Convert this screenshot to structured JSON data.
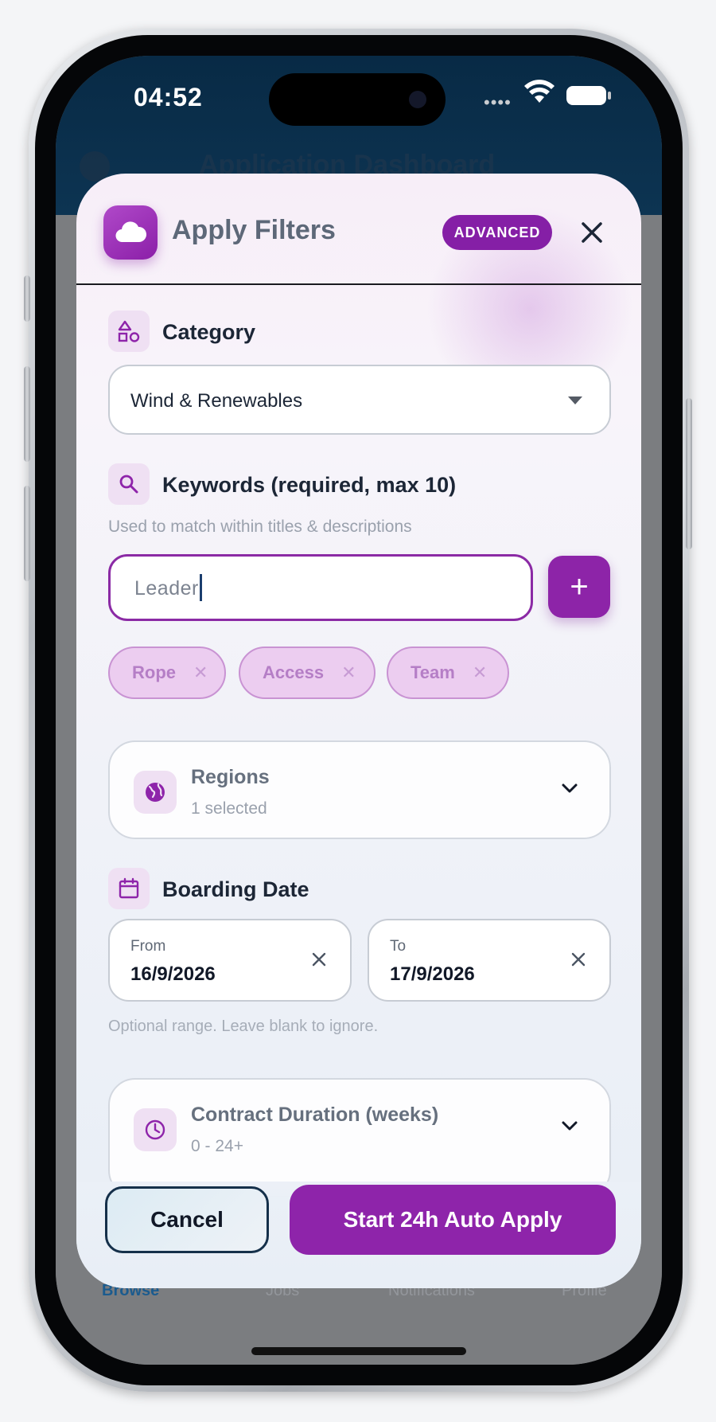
{
  "status_bar": {
    "time": "04:52",
    "signal_dots": "••••"
  },
  "background": {
    "header_title": "Application Dashboard",
    "nav": [
      "Browse",
      "Jobs",
      "Notifications",
      "Profile"
    ],
    "nav_active": "Browse"
  },
  "modal": {
    "title": "Apply Filters",
    "badge": "ADVANCED",
    "category": {
      "label": "Category",
      "selected": "Wind & Renewables"
    },
    "keywords": {
      "label": "Keywords (required, max 10)",
      "helper": "Used to match within titles & descriptions",
      "input_value": "Leader",
      "add_label": "+",
      "chips": [
        {
          "label": "Rope"
        },
        {
          "label": "Access"
        },
        {
          "label": "Team"
        }
      ]
    },
    "regions": {
      "title": "Regions",
      "subtitle": "1 selected"
    },
    "boarding_date": {
      "label": "Boarding Date",
      "from_label": "From",
      "from_value": "16/9/2026",
      "to_label": "To",
      "to_value": "17/9/2026",
      "helper": "Optional range. Leave blank to ignore."
    },
    "contract_duration": {
      "title": "Contract Duration (weeks)",
      "subtitle": "0 - 24+"
    },
    "cancel_label": "Cancel",
    "primary_label": "Start 24h Auto Apply"
  },
  "colors": {
    "accent": "#8e24aa",
    "chip_bg": "#eccdf0",
    "text_dark": "#1c2636",
    "header_bg": "#082a45"
  },
  "icons": {
    "app": "cloud-icon",
    "close": "close-icon",
    "category": "shapes-icon",
    "keywords": "search-icon",
    "regions": "globe-icon",
    "boarding": "calendar-icon",
    "duration": "clock-icon"
  }
}
